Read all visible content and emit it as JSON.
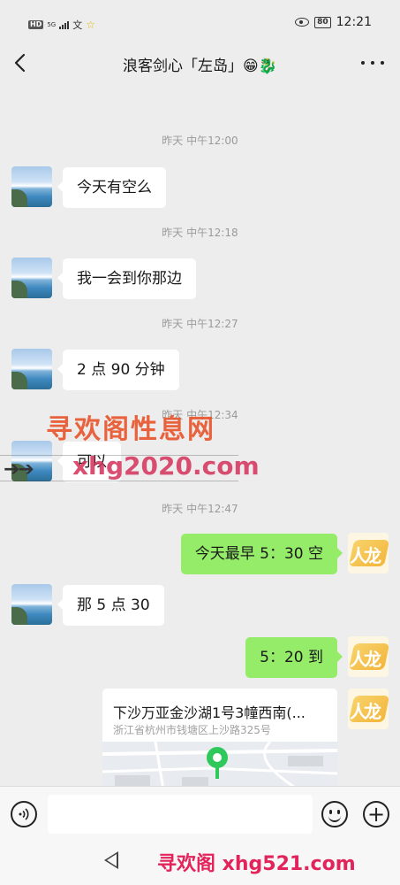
{
  "status_bar": {
    "hd": "HD",
    "net": "5G",
    "wen_icon": "文",
    "star_icon": "☆",
    "battery": "80",
    "time": "12:21"
  },
  "header": {
    "title": "浪客剑心「左岛」",
    "emoji_1": "😁",
    "emoji_2": "🐉",
    "back_icon": "back-arrow-icon",
    "more_icon": "more-dots-icon"
  },
  "messages": [
    {
      "type": "time",
      "text": "昨天 中午12:00"
    },
    {
      "type": "in",
      "text": "今天有空么"
    },
    {
      "type": "time",
      "text": "昨天 中午12:18"
    },
    {
      "type": "in",
      "text": "我一会到你那边"
    },
    {
      "type": "time",
      "text": "昨天 中午12:27"
    },
    {
      "type": "in",
      "text": "2 点 90 分钟"
    },
    {
      "type": "time",
      "text": "昨天 中午12:34"
    },
    {
      "type": "in",
      "text": "可以"
    },
    {
      "type": "time",
      "text": "昨天 中午12:47"
    },
    {
      "type": "out",
      "text": "今天最早 5：30 空"
    },
    {
      "type": "in",
      "text": "那 5 点 30"
    },
    {
      "type": "out",
      "text": "5：20 到"
    }
  ],
  "location_card": {
    "title": "下沙万亚金沙湖1号3幢西南(...",
    "address": "浙江省杭州市钱塘区上沙路325号"
  },
  "watermarks": {
    "line1": "寻欢阁性息网",
    "line2": "xhg2020.com",
    "line3": "寻欢阁 xhg521.com",
    "arrow": "➔➔"
  },
  "input_bar": {
    "placeholder": "",
    "voice_icon": "voice-icon",
    "emoji_icon": "emoji-icon",
    "plus": "+"
  }
}
